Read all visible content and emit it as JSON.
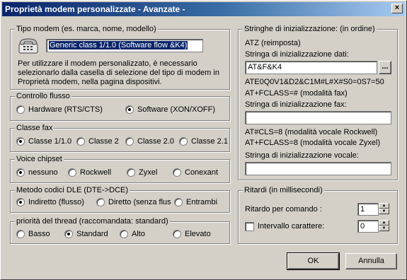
{
  "window": {
    "title": "Proprietà modem personalizzate - Avanzate -",
    "close_glyph": "×"
  },
  "tipo_modem": {
    "legend": "Tipo modem (es. marca, nome, modello)",
    "value": "Generic class 1/1.0 (Software flow &K4)",
    "description": "Per utilizzare il modem personalizzato, è necessario selezionarlo dalla casella di selezione del tipo di modem in Proprietà modem, nella pagina dispositivi."
  },
  "controllo_flusso": {
    "legend": "Controllo flusso",
    "options": [
      "Hardware (RTS/CTS)",
      "Software (XON/XOFF)"
    ],
    "selected": 1
  },
  "classe_fax": {
    "legend": "Classe fax",
    "options": [
      "Classe 1/1.0",
      "Classe 2",
      "Classe 2.0",
      "Classe 2.1"
    ],
    "selected": 0
  },
  "voice_chipset": {
    "legend": "Voice chipset",
    "options": [
      "nessuno",
      "Rockwell",
      "Zyxel",
      "Conexant"
    ],
    "selected": 0
  },
  "metodo_dle": {
    "legend": "Metodo codici DLE (DTE->DCE)",
    "options": [
      "Indiretto (flusso)",
      "Diretto (senza flus:",
      "Entrambi"
    ],
    "selected": 0
  },
  "priorita": {
    "legend": "priorità del thread (raccomandata: standard)",
    "options": [
      "Basso",
      "Standard",
      "Alto",
      "Elevato"
    ],
    "selected": 1
  },
  "stringhe": {
    "legend": "Stringhe di inizializzazione: (in ordine)",
    "reset": "ATZ (reimposta)",
    "dati_label": "Stringa di inizializzazione dati:",
    "dati_value": "AT&F&K4",
    "browse_label": "...",
    "dati_extra": "ATE0Q0V1&D2&C1M#L#X#S0=0S7=50",
    "fax_info": "AT+FCLASS=# (modalità fax)",
    "fax_label": "Stringa di inizializzazione fax:",
    "fax_value": "",
    "vocale_rockwell": "AT#CLS=8 (modalità vocale Rockwell)",
    "vocale_zyxel": "AT+FCLASS=8 (modalità vocale Zyxel)",
    "vocale_label": "Stringa di inizializzazione vocale:",
    "vocale_value": ""
  },
  "ritardi": {
    "legend": "Ritardi (in millisecondi)",
    "comando_label": "Ritardo per comando :",
    "comando_value": "1",
    "intervallo_label": "Intervallo carattere:",
    "intervallo_value": "0",
    "intervallo_checked": false
  },
  "buttons": {
    "ok": "OK",
    "cancel": "Annulla"
  }
}
